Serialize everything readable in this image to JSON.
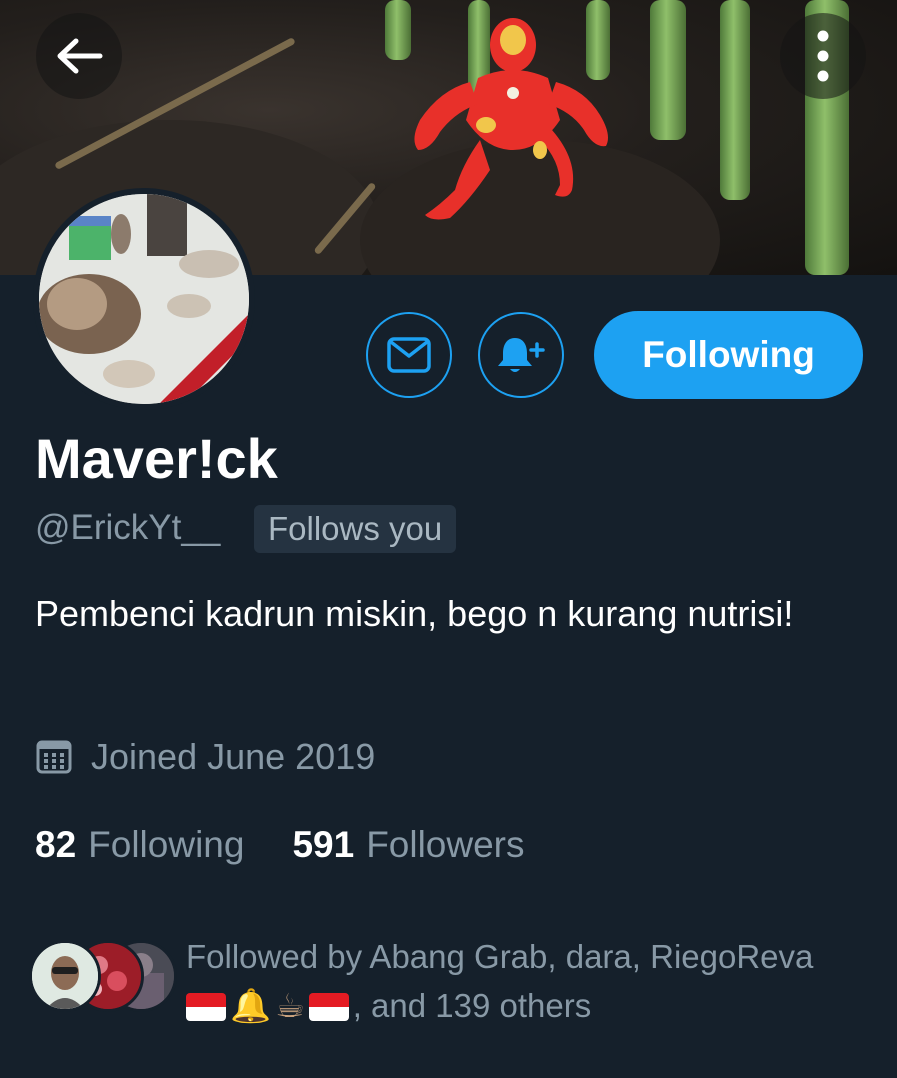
{
  "header": {
    "back_icon": "arrow-left-icon",
    "more_icon": "vertical-dots-icon"
  },
  "actions": {
    "message_icon": "envelope-icon",
    "notify_icon": "bell-plus-icon",
    "follow_label": "Following"
  },
  "profile": {
    "name": "Maver!ck",
    "handle": "@ErickYt__",
    "follows_you": "Follows you",
    "bio": "Pembenci kadrun miskin, bego n kurang nutrisi!",
    "joined": "Joined June 2019"
  },
  "stats": {
    "following_count": "82",
    "following_label": "Following",
    "followers_count": "591",
    "followers_label": "Followers"
  },
  "followed_by": {
    "prefix": "Followed by Abang Grab, dara, RiegoReva",
    "emojis": [
      "flag-indonesia",
      "bell",
      "coffee",
      "flag-indonesia"
    ],
    "bell_glyph": "🔔",
    "coffee_glyph": "☕",
    "suffix": ", and 139 others"
  },
  "colors": {
    "background": "#15202b",
    "accent": "#1da1f2",
    "muted_text": "#8899a6"
  }
}
